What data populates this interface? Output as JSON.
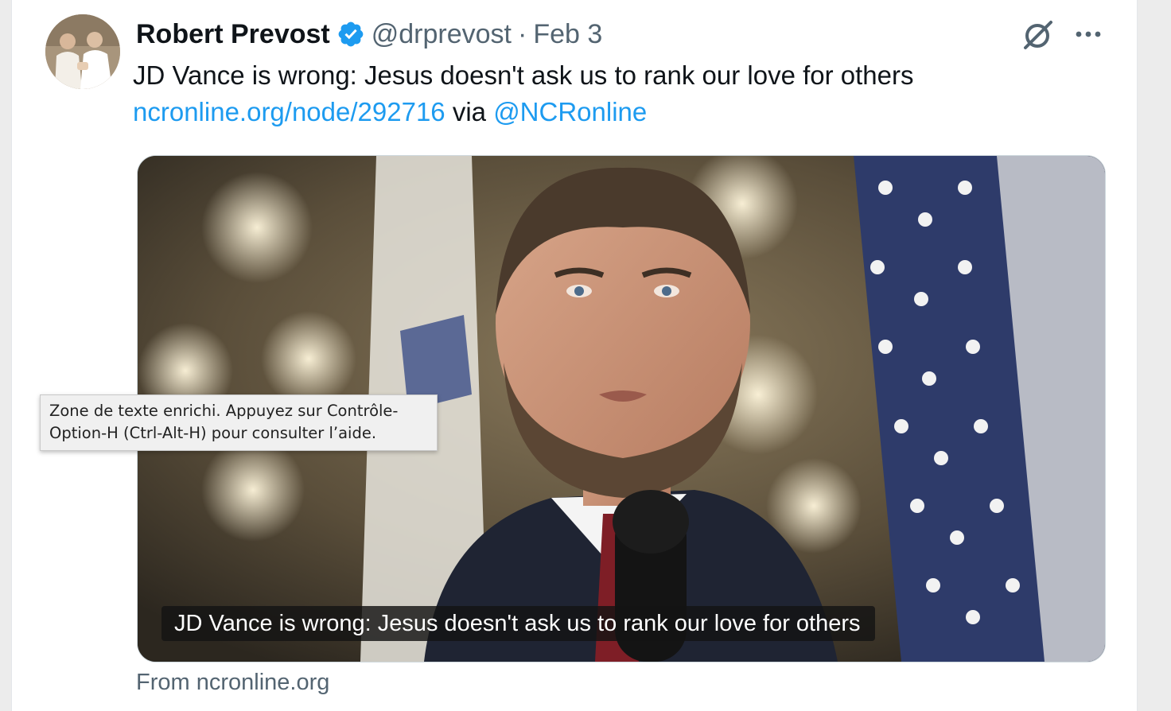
{
  "tweet": {
    "author": {
      "display_name": "Robert Prevost",
      "handle": "@drprevost",
      "verified": true
    },
    "separator": "·",
    "date": "Feb 3",
    "text": {
      "line1": "JD Vance is wrong: Jesus doesn't ask us to rank our love for others",
      "link_url_text": "ncronline.org/node/292716",
      "via_text": " via ",
      "mention": "@NCRonline"
    },
    "media": {
      "caption": "JD Vance is wrong: Jesus doesn't ask us to rank our love for others"
    },
    "source": "From ncronline.org"
  },
  "tooltip": {
    "line1": "Zone de texte enrichi. Appuyez sur Contrôle-",
    "line2": "Option-H (Ctrl-Alt-H) pour consulter l’aide."
  },
  "icons": {
    "verified": "verified-badge-icon",
    "grok": "grok-icon",
    "more": "more-options-icon"
  },
  "colors": {
    "link": "#1d9bf0",
    "verified": "#1d9bf0",
    "text": "#0f1419",
    "secondary": "#536471"
  }
}
